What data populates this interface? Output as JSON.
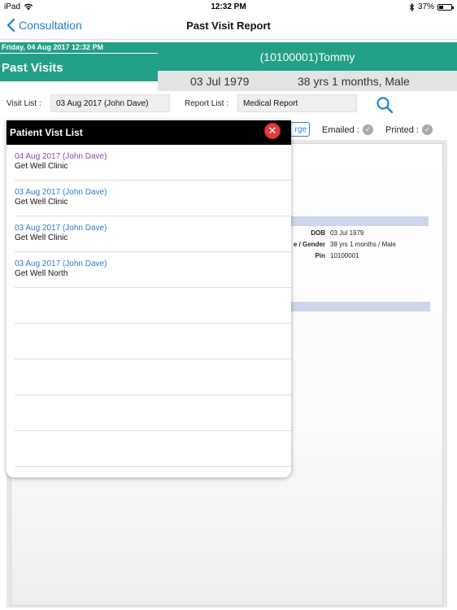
{
  "status_bar": {
    "device": "iPad",
    "time": "12:32 PM",
    "battery": "37%"
  },
  "nav": {
    "back_label": "Consultation",
    "title": "Past Visit Report"
  },
  "header": {
    "datetime": "Friday, 04 Aug 2017  12:32 PM",
    "section_title": "Past Visits",
    "patient_name": "(10100001)Tommy",
    "dob": "03 Jul 1979",
    "age_gender": "38 yrs 1 months, Male"
  },
  "filters": {
    "visit_list_label": "Visit List :",
    "visit_list_value": "03 Aug 2017 (John Dave)",
    "report_list_label": "Report List :",
    "report_list_value": "Medical Report"
  },
  "toolbar": {
    "merge_label": "rge",
    "emailed_label": "Emailed :",
    "printed_label": "Printed :"
  },
  "report": {
    "rows": [
      {
        "key": "DOB",
        "value": "03 Jul 1979"
      },
      {
        "key": "e / Gender",
        "value": "38 yrs 1 months / Male"
      },
      {
        "key": "Pin",
        "value": "10100001"
      }
    ]
  },
  "popup": {
    "title": "Patient Vist List",
    "items": [
      {
        "date_doctor": "04 Aug 2017 (John Dave)",
        "clinic": "Get Well Clinic"
      },
      {
        "date_doctor": "03 Aug 2017 (John Dave)",
        "clinic": "Get Well Clinic"
      },
      {
        "date_doctor": "03 Aug 2017 (John Dave)",
        "clinic": "Get Well Clinic"
      },
      {
        "date_doctor": "03 Aug 2017 (John Dave)",
        "clinic": "Get Well North"
      }
    ]
  },
  "colors": {
    "teal": "#22a087",
    "link": "#2a7bd0",
    "visited": "#7c4ea8",
    "close": "#e23c3c"
  }
}
